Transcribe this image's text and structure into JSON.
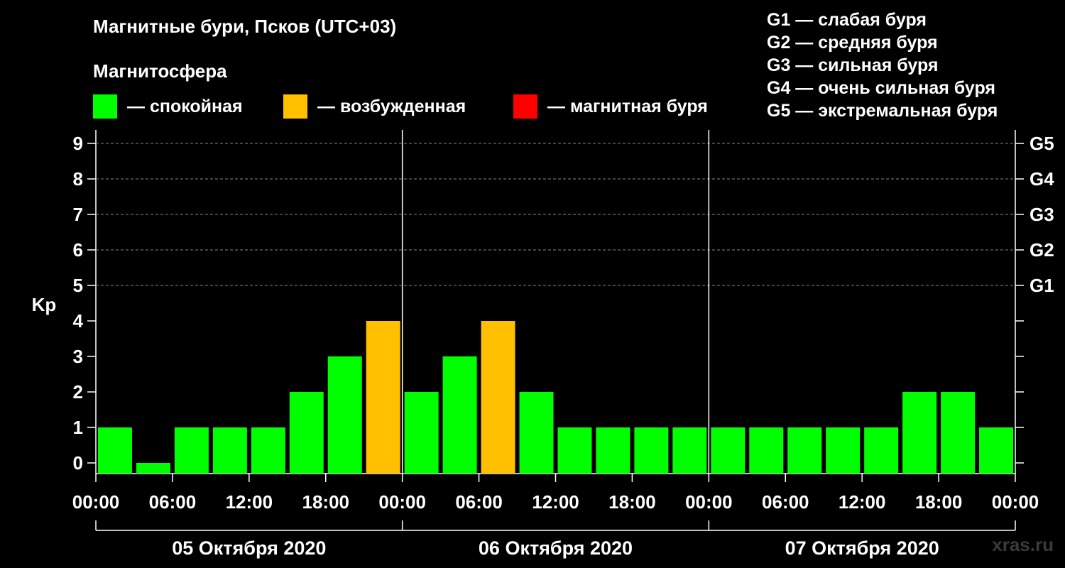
{
  "title": "Магнитные бури, Псков (UTC+03)",
  "subtitle": "Магнитосфера",
  "legend": [
    {
      "label": "— спокойная",
      "color": "#00ff00"
    },
    {
      "label": "— возбужденная",
      "color": "#ffc000"
    },
    {
      "label": "— магнитная буря",
      "color": "#ff0000"
    }
  ],
  "g_legend": [
    "G1 — слабая буря",
    "G2 — средняя буря",
    "G3 — сильная буря",
    "G4 — очень сильная буря",
    "G5 — экстремальная буря"
  ],
  "watermark": "xras.ru",
  "chart_data": {
    "type": "bar",
    "ylabel": "Kp",
    "ylim": [
      0,
      9
    ],
    "y_ticks": [
      0,
      1,
      2,
      3,
      4,
      5,
      6,
      7,
      8,
      9
    ],
    "y2_ticks": [
      {
        "kp": 5,
        "label": "G1"
      },
      {
        "kp": 6,
        "label": "G2"
      },
      {
        "kp": 7,
        "label": "G3"
      },
      {
        "kp": 8,
        "label": "G4"
      },
      {
        "kp": 9,
        "label": "G5"
      }
    ],
    "x_tick_labels": [
      "00:00",
      "06:00",
      "12:00",
      "18:00",
      "00:00",
      "06:00",
      "12:00",
      "18:00",
      "00:00",
      "06:00",
      "12:00",
      "18:00",
      "00:00"
    ],
    "days": [
      "05 Октября 2020",
      "06 Октября 2020",
      "07 Октября 2020"
    ],
    "interval_hours": 3,
    "values": [
      1,
      0,
      1,
      1,
      1,
      2,
      3,
      4,
      2,
      3,
      4,
      2,
      1,
      1,
      1,
      1,
      1,
      1,
      1,
      1,
      1,
      2,
      2,
      1
    ],
    "colors": {
      "quiet": "#00ff00",
      "active": "#ffc000",
      "storm": "#ff0000"
    },
    "grid": true
  }
}
